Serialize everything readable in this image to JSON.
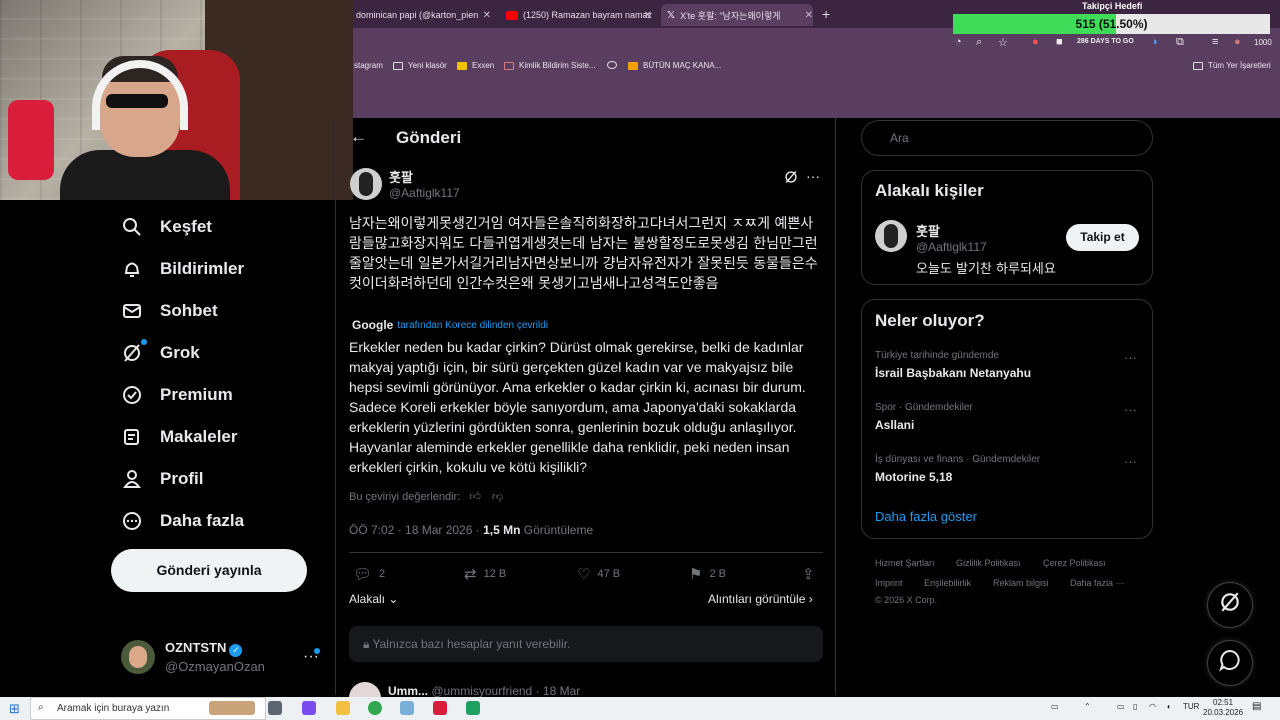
{
  "browser": {
    "tabs": [
      {
        "label": "dominican papi (@karton_pien",
        "icon_color": "#d0d0d0"
      },
      {
        "label": "(1250) Ramazan bayram namaz",
        "icon_color": "#ff0000"
      },
      {
        "label": "X'te 훗팔: \"남자는왜이렇게",
        "icon_color": "#ffffff"
      }
    ],
    "new_tab": "+",
    "days_text": "286 DAYS TO GO",
    "profile_count": "1000",
    "bookmarks": [
      {
        "label": "stagram"
      },
      {
        "label": "Yeni klasör"
      },
      {
        "label": "Exxen"
      },
      {
        "label": "Kimlik Bildirim Siste..."
      },
      {
        "label": ""
      },
      {
        "label": "BÜTÜN MAÇ KANA..."
      }
    ],
    "all_bookmarks": "Tüm Yer İşaretleri"
  },
  "overlay": {
    "goal_title": "Takipçi Hedefi",
    "goal_text": "515 (51.50%)",
    "goal_percent": 51.5
  },
  "nav": {
    "items": [
      {
        "label": "Keşfet",
        "icon": "search-icon"
      },
      {
        "label": "Bildirimler",
        "icon": "bell-icon"
      },
      {
        "label": "Sohbet",
        "icon": "mail-icon"
      },
      {
        "label": "Grok",
        "icon": "grok-icon"
      },
      {
        "label": "Premium",
        "icon": "premium-icon"
      },
      {
        "label": "Makaleler",
        "icon": "article-icon"
      },
      {
        "label": "Profil",
        "icon": "person-icon"
      },
      {
        "label": "Daha fazla",
        "icon": "more-circle-icon"
      }
    ],
    "post_button": "Gönderi yayınla",
    "account": {
      "name": "OZNTSTN",
      "handle": "@OzmayanOzan",
      "more": "···"
    }
  },
  "post": {
    "page_title": "Gönderi",
    "author_name": "훗팔",
    "author_handle": "@Aaftiglk117",
    "text_original": "남자는왜이렇게못생긴거임 여자들은솔직히화장하고다녀서그런지 ㅈㅉ게 예쁜사람들많고화장지워도 다들귀엽게생겻는데 남자는 불쌍할정도로못생김 한님만그런줄알앗는데 일본가서길거리남자면상보니까 걍남자유전자가 잘못된듯 동물들은수컷이더화려하던데 인간수컷은왜 못생기고냄새나고성격도안좋음",
    "translated_by_brand": "Google",
    "translated_by": "tarafından Korece dilinden çevrildi",
    "text_translated": "Erkekler neden bu kadar çirkin? Dürüst olmak gerekirse, belki de kadınlar makyaj yaptığı için, bir sürü gerçekten güzel kadın var ve makyajsız bile hepsi sevimli görünüyor. Ama erkekler o kadar çirkin ki, acınası bir durum. Sadece Koreli erkekler böyle sanıyordum, ama Japonya'daki sokaklarda erkeklerin yüzlerini gördükten sonra, genlerinin bozuk olduğu anlaşılıyor. Hayvanlar aleminde erkekler genellikle daha renklidir, peki neden insan erkekleri çirkin, kokulu ve kötü kişilikli?",
    "rate_translation": "Bu çeviriyi değerlendir:",
    "timestamp": "ÖÖ 7:02 · 18 Mar 2026 ·",
    "views_count": "1,5 Mn",
    "views_label": "Görüntüleme",
    "replies": "2",
    "reposts": "12 B",
    "likes": "47 B",
    "bookmarks": "2 B",
    "relevance": "Alakalı",
    "quotes": "Alıntıları görüntüle",
    "reply_restricted": "Yalnızca bazı hesaplar yanıt verebilir.",
    "next_reply_name": "Umm...",
    "next_reply_meta": "@ummisyourfriend · 18 Mar"
  },
  "sidebar": {
    "search_placeholder": "Ara",
    "relevant_title": "Alakalı kişiler",
    "relevant_person": {
      "name": "훗팔",
      "handle": "@Aaftiglk117",
      "bio": "오늘도 발기찬 하루되세요",
      "follow": "Takip et"
    },
    "trends_title": "Neler oluyor?",
    "trends": [
      {
        "category": "Türkiye tarihinde gündemde",
        "name": "İsrail Başbakanı Netanyahu"
      },
      {
        "category": "Spor · Gündemdekiler",
        "name": "Asllani"
      },
      {
        "category": "İş dünyası ve finans · Gündemdekiler",
        "name": "Motorine 5,18"
      }
    ],
    "show_more": "Daha fazla göster",
    "footer": {
      "terms": "Hizmet Şartları",
      "privacy": "Gizlilik Politikası",
      "cookies": "Çerez Politikası",
      "imprint": "Imprint",
      "accessibility": "Erişilebilirlik",
      "ads": "Reklam bilgisi",
      "more": "Daha fazla ···",
      "copyright": "© 2026 X Corp."
    }
  },
  "taskbar": {
    "search_placeholder": "Aramak için buraya yazın",
    "lang": "TUR",
    "time": "02:51",
    "date": "20.03.2026"
  },
  "colors": {
    "accent": "#1d9bf0",
    "background": "#000000",
    "browser_chrome": "#5a3e60",
    "goal_fill": "#3fdc5a"
  }
}
